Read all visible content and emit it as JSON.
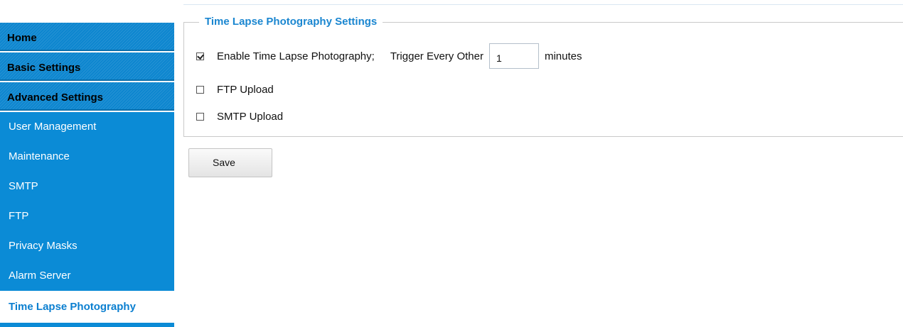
{
  "sidebar": {
    "categories": [
      {
        "label": "Home"
      },
      {
        "label": "Basic Settings"
      },
      {
        "label": "Advanced Settings"
      }
    ],
    "items": [
      {
        "label": "User Management"
      },
      {
        "label": "Maintenance"
      },
      {
        "label": "SMTP"
      },
      {
        "label": "FTP"
      },
      {
        "label": "Privacy Masks"
      },
      {
        "label": "Alarm Server"
      }
    ],
    "active_item": {
      "label": "Time Lapse Photography"
    }
  },
  "settings": {
    "legend": "Time Lapse Photography Settings",
    "enable_time_lapse": {
      "label": "Enable Time Lapse Photography;",
      "checked": true
    },
    "trigger_label": "Trigger Every Other",
    "trigger_value": "1",
    "trigger_unit": "minutes",
    "ftp_upload": {
      "label": "FTP Upload",
      "checked": false
    },
    "smtp_upload": {
      "label": "SMTP Upload",
      "checked": false
    }
  },
  "actions": {
    "save_label": "Save"
  },
  "colors": {
    "sidebar_blue": "#0b8bd6",
    "accent": "#1a86d0"
  }
}
